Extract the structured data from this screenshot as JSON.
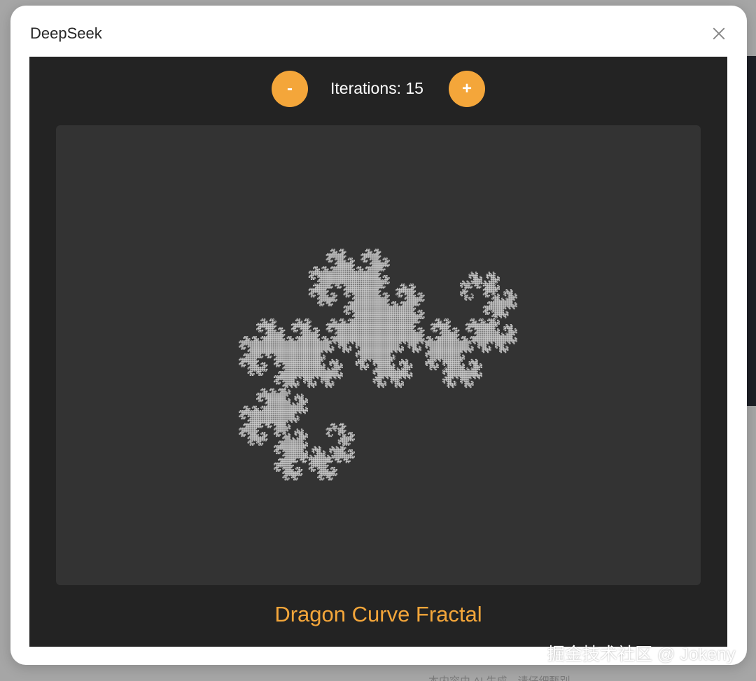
{
  "dialog": {
    "title": "DeepSeek",
    "close_icon": "close-icon"
  },
  "controls": {
    "decrease_label": "-",
    "increase_label": "+",
    "iterations_text": "Iterations: 15",
    "iterations": 15
  },
  "fractal": {
    "title": "Dragon Curve Fractal",
    "line_color": "#d6d6d6",
    "canvas_background": "#333333"
  },
  "colors": {
    "accent": "#f4a63a",
    "app_background": "#232323",
    "title_color": "#f4a63a"
  },
  "background": {
    "bottom_text": "本内容由 AI 生成，请仔细甄别"
  },
  "watermark": {
    "text": "掘金技术社区 @ Jokeny"
  }
}
